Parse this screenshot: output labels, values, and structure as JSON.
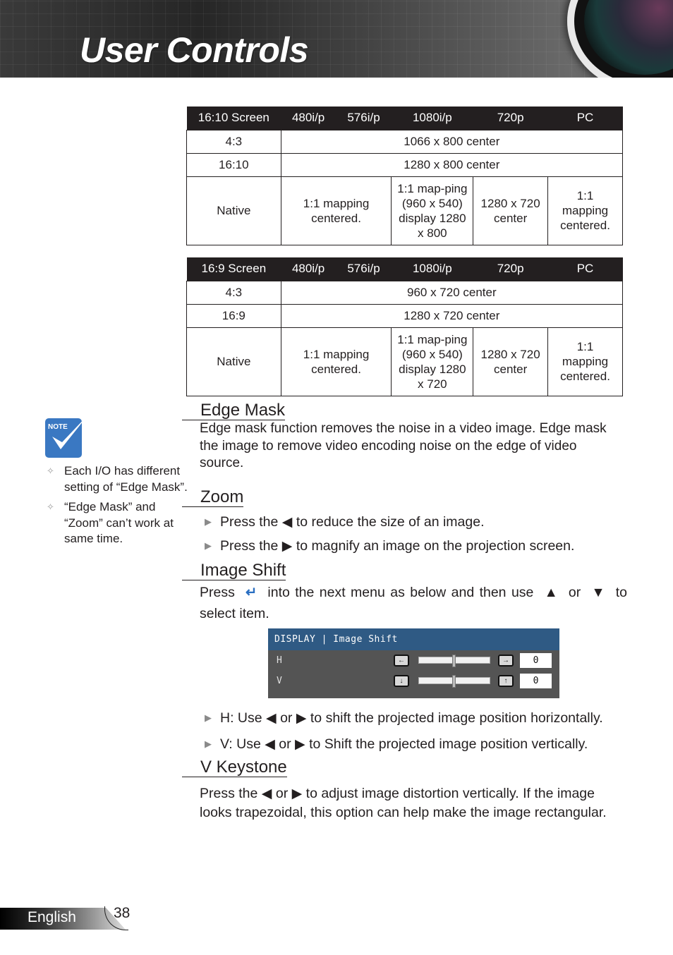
{
  "header": {
    "title": "User Controls"
  },
  "tables": [
    {
      "headers": [
        "16:10 Screen",
        "480i/p",
        "576i/p",
        "1080i/p",
        "720p",
        "PC"
      ],
      "rows": [
        {
          "label": "4:3",
          "merged": "1066 x 800 center"
        },
        {
          "label": "16:10",
          "merged": "1280 x 800 center"
        },
        {
          "label": "Native",
          "cells": [
            "1:1 mapping centered.",
            "1:1 map-ping (960 x 540) display 1280 x 800",
            "1280 x 720 center",
            "1:1 mapping centered."
          ]
        }
      ]
    },
    {
      "headers": [
        "16:9 Screen",
        "480i/p",
        "576i/p",
        "1080i/p",
        "720p",
        "PC"
      ],
      "rows": [
        {
          "label": "4:3",
          "merged": "960 x 720 center"
        },
        {
          "label": "16:9",
          "merged": "1280 x 720 center"
        },
        {
          "label": "Native",
          "cells": [
            "1:1 mapping centered.",
            "1:1 map-ping (960 x 540) display 1280 x 720",
            "1280 x 720 center",
            "1:1 mapping centered."
          ]
        }
      ]
    }
  ],
  "note": {
    "icon_label": "NOTE",
    "items": [
      "Each I/O has different setting of “Edge Mask”.",
      "“Edge Mask” and “Zoom” can’t work at same time."
    ]
  },
  "sections": {
    "edge_mask": {
      "title": "Edge Mask",
      "body": "Edge mask function removes the noise in a video image. Edge mask the image to remove video encoding noise on the edge of video source."
    },
    "zoom": {
      "title": "Zoom",
      "bullets": [
        {
          "pre": "Press the",
          "icon": "◀",
          "post": "to reduce the size of an image."
        },
        {
          "pre": "Press the",
          "icon": "▶",
          "post": "to magnify an image on the projection screen."
        }
      ]
    },
    "image_shift": {
      "title": "Image Shift",
      "intro_pre": "Press",
      "intro_mid": "into the next menu as below and then use",
      "intro_or": "or",
      "intro_post": "to",
      "intro_line2": "select item.",
      "bullets": [
        {
          "pre": "H: Use",
          "or": "or",
          "post": "to shift the projected image position horizontally."
        },
        {
          "pre": "V: Use",
          "or": "or",
          "post": "to Shift the projected image position vertically."
        }
      ]
    },
    "v_keystone": {
      "title": "V Keystone",
      "line1_pre": "Press the",
      "line1_or": "or",
      "line1_post": "to adjust image distortion vertically. If the image",
      "line2": "looks trapezoidal, this option can help make the image rectangular."
    }
  },
  "osd": {
    "title": "DISPLAY | Image Shift",
    "rows": [
      {
        "label": "H",
        "value": "0",
        "position": 0.5
      },
      {
        "label": "V",
        "value": "0",
        "position": 0.5
      }
    ],
    "colors": {
      "title_bar": "#2f5a84",
      "panel": "#545454"
    }
  },
  "footer": {
    "language": "English",
    "page": "38"
  }
}
